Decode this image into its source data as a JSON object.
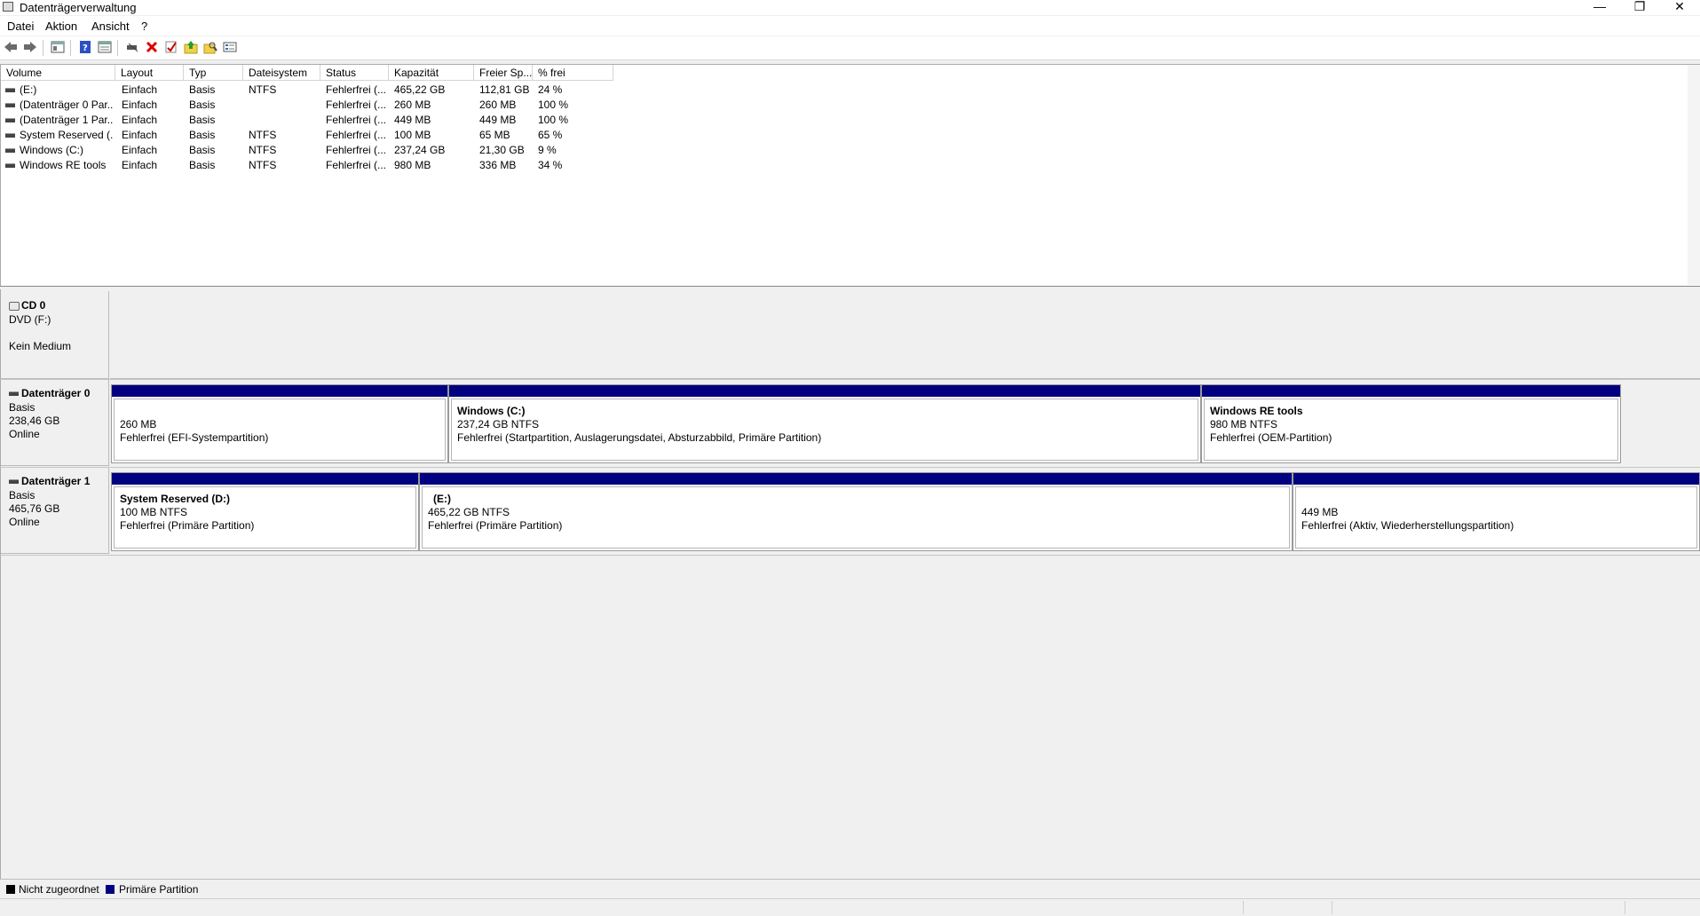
{
  "window": {
    "title": "Datenträgerverwaltung",
    "minimize": "—",
    "restore": "❐",
    "close": "✕"
  },
  "menu": {
    "items": [
      "Datei",
      "Aktion",
      "Ansicht",
      "?"
    ]
  },
  "toolbar": {
    "icons": [
      "back-icon",
      "forward-icon",
      "show-hide-console-tree-icon",
      "help-icon",
      "properties-view-icon",
      "connect-disk-icon",
      "delete-icon",
      "checkmark-icon",
      "up-folder-icon",
      "search-folder-icon",
      "list-view-icon"
    ]
  },
  "volume_list": {
    "columns": [
      "Volume",
      "Layout",
      "Typ",
      "Dateisystem",
      "Status",
      "Kapazität",
      "Freier Sp...",
      "% frei"
    ],
    "rows": [
      [
        "(E:)",
        "Einfach",
        "Basis",
        "NTFS",
        "Fehlerfrei (...",
        "465,22 GB",
        "112,81 GB",
        "24 %"
      ],
      [
        "(Datenträger 0 Par...",
        "Einfach",
        "Basis",
        "",
        "Fehlerfrei (...",
        "260 MB",
        "260 MB",
        "100 %"
      ],
      [
        "(Datenträger 1 Par...",
        "Einfach",
        "Basis",
        "",
        "Fehlerfrei (...",
        "449 MB",
        "449 MB",
        "100 %"
      ],
      [
        "System Reserved (...",
        "Einfach",
        "Basis",
        "NTFS",
        "Fehlerfrei (...",
        "100 MB",
        "65 MB",
        "65 %"
      ],
      [
        "Windows (C:)",
        "Einfach",
        "Basis",
        "NTFS",
        "Fehlerfrei (...",
        "237,24 GB",
        "21,30 GB",
        "9 %"
      ],
      [
        "Windows RE tools",
        "Einfach",
        "Basis",
        "NTFS",
        "Fehlerfrei (...",
        "980 MB",
        "336 MB",
        "34 %"
      ]
    ]
  },
  "disks": {
    "cd0": {
      "name": "CD 0",
      "type": "DVD (F:)",
      "media": "Kein Medium"
    },
    "disk0": {
      "name": "Datenträger 0",
      "kind": "Basis",
      "size": "238,46 GB",
      "state": "Online",
      "partitions": [
        {
          "title": "",
          "size": "260 MB",
          "status": "Fehlerfrei (EFI-Systempartition)"
        },
        {
          "title": "Windows  (C:)",
          "size": "237,24 GB NTFS",
          "status": "Fehlerfrei (Startpartition, Auslagerungsdatei, Absturzabbild, Primäre Partition)"
        },
        {
          "title": "Windows RE tools",
          "size": "980 MB NTFS",
          "status": "Fehlerfrei (OEM-Partition)"
        }
      ]
    },
    "disk1": {
      "name": "Datenträger 1",
      "kind": "Basis",
      "size": "465,76 GB",
      "state": "Online",
      "partitions": [
        {
          "title": "System Reserved  (D:)",
          "size": "100 MB NTFS",
          "status": "Fehlerfrei (Primäre Partition)"
        },
        {
          "title": "(E:)",
          "size": "465,22 GB NTFS",
          "status": "Fehlerfrei (Primäre Partition)"
        },
        {
          "title": "",
          "size": "449 MB",
          "status": "Fehlerfrei (Aktiv, Wiederherstellungspartition)"
        }
      ]
    }
  },
  "legend": {
    "items": [
      {
        "label": "Nicht zugeordnet",
        "color": "#000000"
      },
      {
        "label": "Primäre Partition",
        "color": "#000080"
      }
    ]
  }
}
